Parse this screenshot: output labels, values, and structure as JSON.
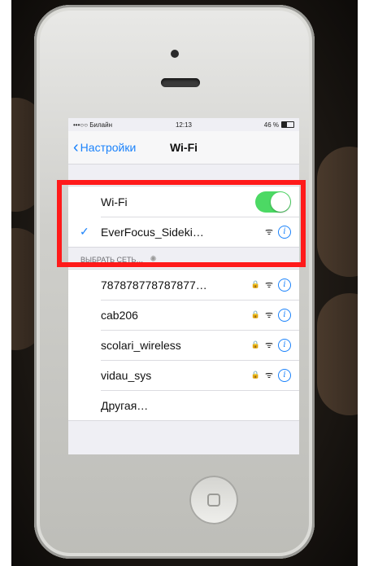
{
  "status_bar": {
    "carrier": "•••○○ Билайн",
    "time": "12:13",
    "battery": "46 %"
  },
  "nav": {
    "back_label": "Настройки",
    "title": "Wi-Fi"
  },
  "wifi": {
    "toggle_label": "Wi-Fi",
    "toggle_on": true,
    "connected_network": "EverFocus_Sideki…"
  },
  "section_header": "ВЫБРАТЬ СЕТЬ…",
  "networks": [
    {
      "name": "787878778787877…",
      "locked": true
    },
    {
      "name": "cab206",
      "locked": true
    },
    {
      "name": "scolari_wireless",
      "locked": true
    },
    {
      "name": "vidau_sys",
      "locked": true
    }
  ],
  "other_network": "Другая…",
  "colors": {
    "accent": "#1a82fb",
    "toggle_on": "#4cd964",
    "highlight": "#ff1a1a"
  }
}
